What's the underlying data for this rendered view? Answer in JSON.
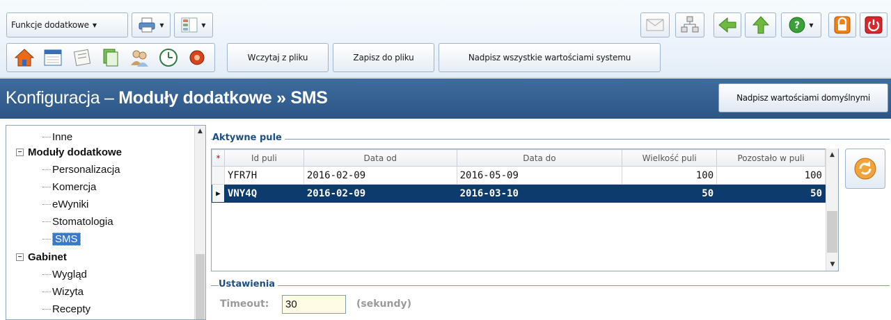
{
  "toolbar": {
    "functions_label": "Funkcje dodatkowe",
    "load_label": "Wczytaj z pliku",
    "save_label": "Zapisz do pliku",
    "overwrite_all_label": "Nadpisz wszystkie wartościami systemu"
  },
  "header": {
    "title_prefix": "Konfiguracja – ",
    "title_bold": "Moduły dodatkowe » SMS",
    "defaults_label": "Nadpisz wartościami domyślnymi"
  },
  "tree": {
    "items": [
      {
        "label": "Inne"
      },
      {
        "label": "Moduły dodatkowe",
        "expander": "−"
      },
      {
        "label": "Personalizacja"
      },
      {
        "label": "Komercja"
      },
      {
        "label": "eWyniki"
      },
      {
        "label": "Stomatologia"
      },
      {
        "label": "SMS"
      },
      {
        "label": "Gabinet",
        "expander": "−"
      },
      {
        "label": "Wygląd"
      },
      {
        "label": "Wizyta"
      },
      {
        "label": "Recepty"
      }
    ]
  },
  "pools": {
    "group_title": "Aktywne pule",
    "columns": [
      "Id puli",
      "Data od",
      "Data do",
      "Wielkość puli",
      "Pozostało w puli"
    ],
    "rows": [
      {
        "id": "YFR7H",
        "from": "2016-02-09",
        "to": "2016-05-09",
        "size": "100",
        "left": "100"
      },
      {
        "id": "VNY4Q",
        "from": "2016-02-09",
        "to": "2016-03-10",
        "size": "50",
        "left": "50"
      }
    ],
    "selected_row": 1
  },
  "settings": {
    "group_title": "Ustawienia",
    "timeout_label": "Timeout:",
    "timeout_value": "30",
    "timeout_unit": "(sekundy)"
  },
  "colors": {
    "header_bg": "#2f5b8c",
    "selected_row": "#0d3b6d",
    "group_title": "#1d4f85"
  }
}
